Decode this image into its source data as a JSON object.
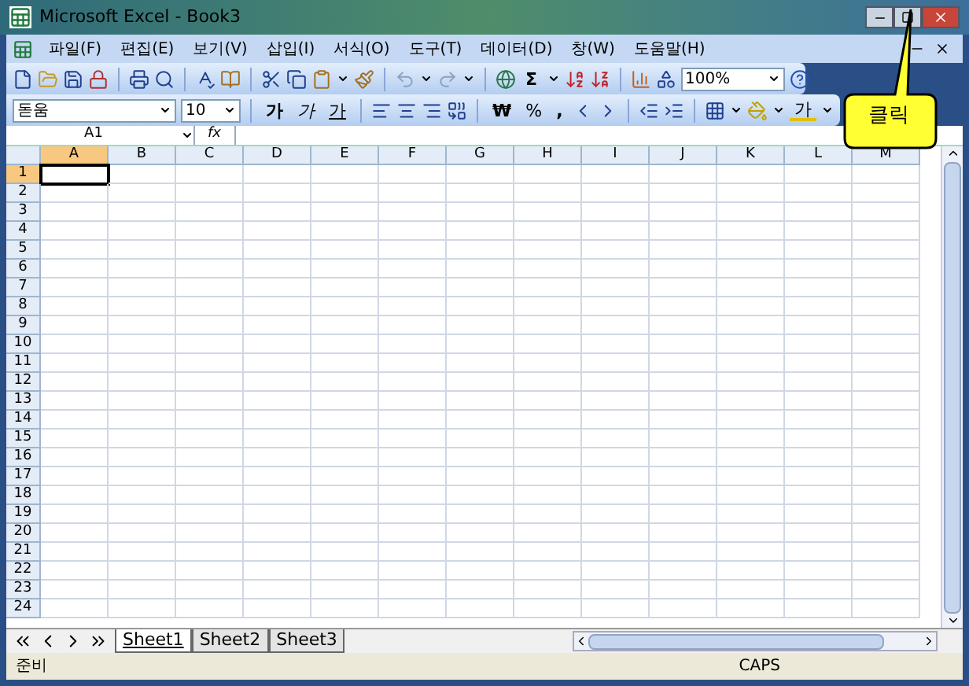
{
  "window": {
    "title": "Microsoft Excel - Book3"
  },
  "menu": {
    "items": [
      "파일(F)",
      "편집(E)",
      "보기(V)",
      "삽입(I)",
      "서식(O)",
      "도구(T)",
      "데이터(D)",
      "창(W)",
      "도움말(H)"
    ]
  },
  "standard_toolbar": {
    "sum": "Σ",
    "zoom": "100%"
  },
  "formatting_toolbar": {
    "font": "돋움",
    "size": "10",
    "bold": "가",
    "italic": "가",
    "underline": "가",
    "currency": "₩",
    "percent": "%",
    "comma": ",",
    "font_color": "가"
  },
  "formula_bar": {
    "name_box": "A1",
    "function": "fx"
  },
  "columns": [
    {
      "label": "A",
      "selected": true
    },
    {
      "label": "B",
      "selected": false
    },
    {
      "label": "C",
      "selected": false
    },
    {
      "label": "D",
      "selected": false
    },
    {
      "label": "E",
      "selected": false
    },
    {
      "label": "F",
      "selected": false
    },
    {
      "label": "G",
      "selected": false
    },
    {
      "label": "H",
      "selected": false
    },
    {
      "label": "I",
      "selected": false
    },
    {
      "label": "J",
      "selected": false
    },
    {
      "label": "K",
      "selected": false
    },
    {
      "label": "L",
      "selected": false
    },
    {
      "label": "M",
      "selected": false
    }
  ],
  "rows": [
    {
      "label": "1",
      "selected": true
    },
    {
      "label": "2",
      "selected": false
    },
    {
      "label": "3",
      "selected": false
    },
    {
      "label": "4",
      "selected": false
    },
    {
      "label": "5",
      "selected": false
    },
    {
      "label": "6",
      "selected": false
    },
    {
      "label": "7",
      "selected": false
    },
    {
      "label": "8",
      "selected": false
    },
    {
      "label": "9",
      "selected": false
    },
    {
      "label": "10",
      "selected": false
    },
    {
      "label": "11",
      "selected": false
    },
    {
      "label": "12",
      "selected": false
    },
    {
      "label": "13",
      "selected": false
    },
    {
      "label": "14",
      "selected": false
    },
    {
      "label": "15",
      "selected": false
    },
    {
      "label": "16",
      "selected": false
    },
    {
      "label": "17",
      "selected": false
    },
    {
      "label": "18",
      "selected": false
    },
    {
      "label": "19",
      "selected": false
    },
    {
      "label": "20",
      "selected": false
    },
    {
      "label": "21",
      "selected": false
    },
    {
      "label": "22",
      "selected": false
    },
    {
      "label": "23",
      "selected": false
    },
    {
      "label": "24",
      "selected": false
    }
  ],
  "sheet_tabs": [
    {
      "label": "Sheet1",
      "selected": true
    },
    {
      "label": "Sheet2",
      "selected": false
    },
    {
      "label": "Sheet3",
      "selected": false
    }
  ],
  "status_bar": {
    "mode": "준비",
    "caps": "CAPS"
  },
  "callout": {
    "text": "클릭"
  }
}
